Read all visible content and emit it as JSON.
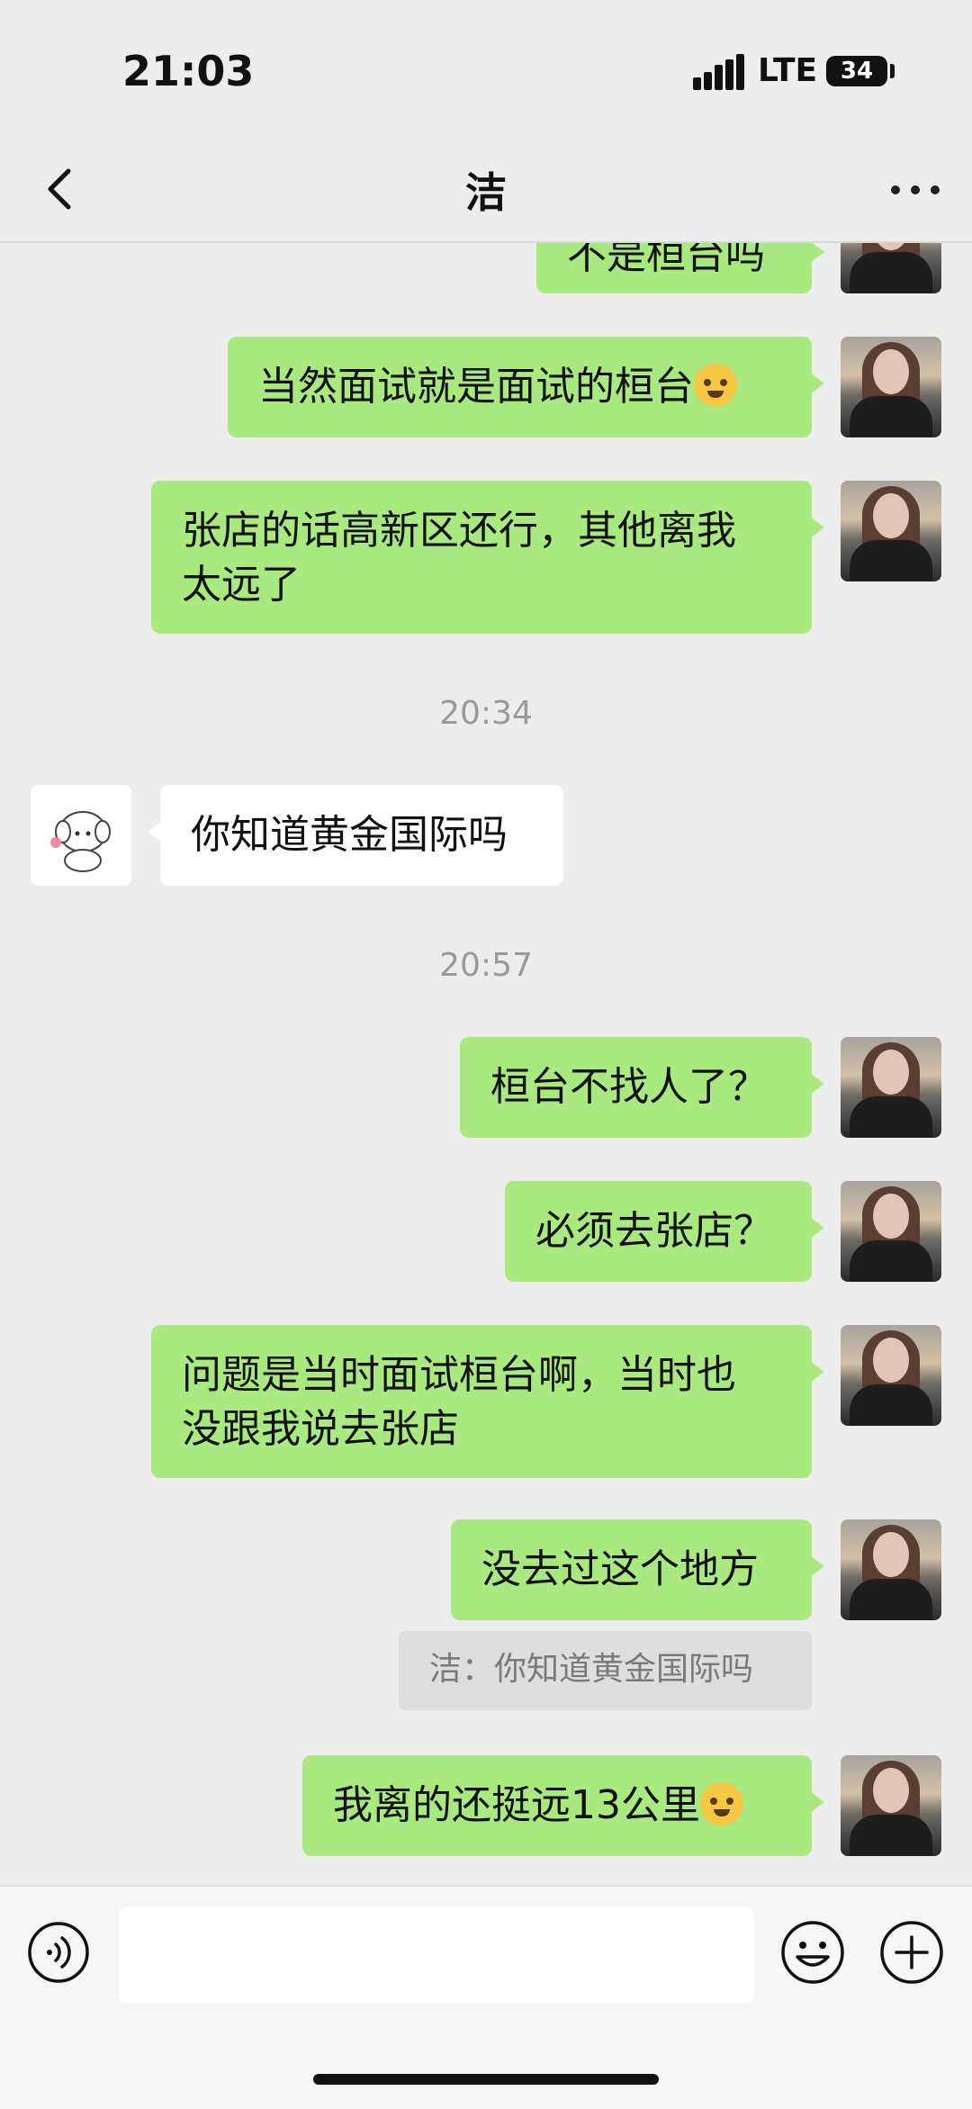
{
  "status_bar": {
    "time": "21:03",
    "network": "LTE",
    "battery": "34"
  },
  "nav": {
    "title": "洁"
  },
  "messages": {
    "m0": "不是桓台吗",
    "m1": "当然面试就是面试的桓台",
    "m2_l1": "张店的话高新区还行，其他离我",
    "m2_l2": "太远了",
    "t1": "20:34",
    "m3": "你知道黄金国际吗",
    "t2": "20:57",
    "m4": "桓台不找人了？",
    "m5": "必须去张店？",
    "m6_l1": "问题是当时面试桓台啊，当时也",
    "m6_l2": "没跟我说去张店",
    "m7": "没去过这个地方",
    "quote": "洁：你知道黄金国际吗",
    "m8": "我离的还挺远13公里"
  },
  "input": {
    "placeholder": ""
  },
  "icons": {
    "back": "chevron-left-icon",
    "more": "more-dots-icon",
    "voice": "voice-icon",
    "emoji": "emoji-icon",
    "plus": "plus-icon"
  },
  "colors": {
    "my_bubble": "#a9e97f",
    "other_bubble": "#ffffff",
    "background": "#ededed"
  }
}
